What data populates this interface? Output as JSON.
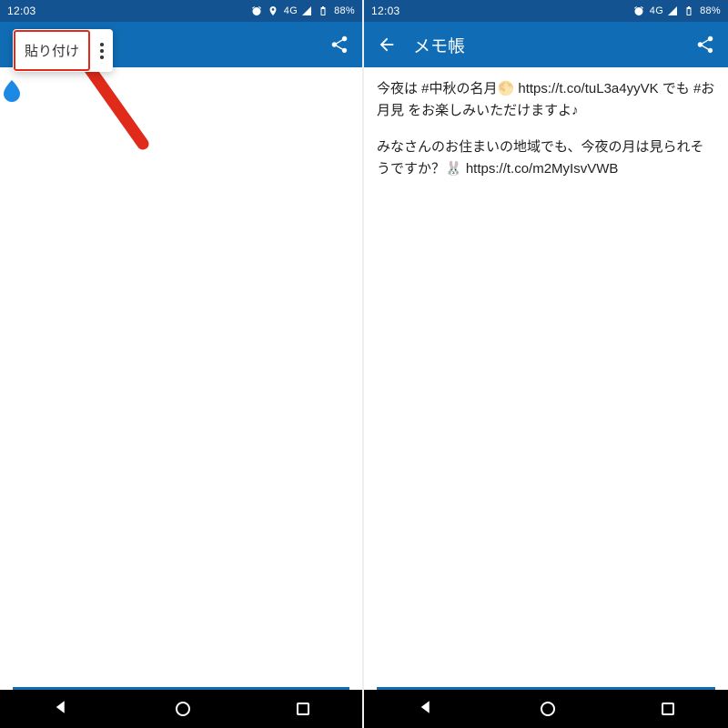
{
  "left": {
    "status": {
      "time": "12:03",
      "net": "4G",
      "battery": "88%"
    },
    "context_menu": {
      "paste_label": "貼り付け"
    }
  },
  "right": {
    "status": {
      "time": "12:03",
      "net": "4G",
      "battery": "88%"
    },
    "appbar": {
      "title": "メモ帳"
    },
    "note": {
      "para1": "今夜は #中秋の名月🌕 https://t.co/tuL3a4yyVK でも #お月見 をお楽しみいただけますよ♪",
      "para2": "みなさんのお住まいの地域でも、今夜の月は見られそうですか？🐰 https://t.co/m2MyIsvVWB"
    }
  }
}
